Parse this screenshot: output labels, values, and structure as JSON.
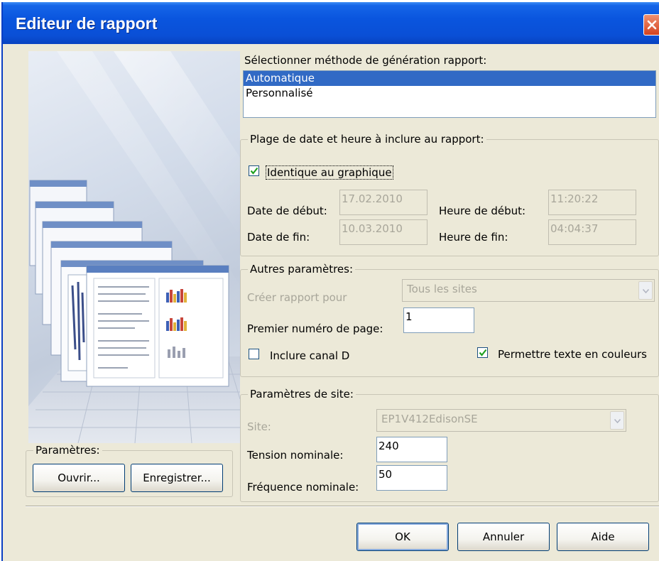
{
  "window": {
    "title": "Editeur de rapport"
  },
  "method": {
    "label": "Sélectionner méthode de génération rapport:",
    "options": [
      "Automatique",
      "Personnalisé"
    ],
    "selected_index": 0
  },
  "date_range": {
    "group_label": "Plage de date et heure à inclure au rapport:",
    "same_as_graph_label": "Identique au graphique",
    "same_as_graph_checked": true,
    "start_date_label": "Date de début:",
    "start_date": "17.02.2010",
    "start_time_label": "Heure de début:",
    "start_time": "11:20:22",
    "end_date_label": "Date de fin:",
    "end_date": "10.03.2010",
    "end_time_label": "Heure de fin:",
    "end_time": "04:04:37"
  },
  "other": {
    "group_label": "Autres paramètres:",
    "create_for_label": "Créer rapport pour",
    "create_for_value": "Tous les sites",
    "first_page_label": "Premier numéro de page:",
    "first_page_value": "1",
    "include_d_label": "Inclure canal D",
    "include_d_checked": false,
    "color_text_label": "Permettre texte en couleurs",
    "color_text_checked": true
  },
  "site": {
    "group_label": "Paramètres de site:",
    "site_label": "Site:",
    "site_value": "EP1V412EdisonSE",
    "voltage_label": "Tension nominale:",
    "voltage_value": "240",
    "frequency_label": "Fréquence nominale:",
    "frequency_value": "50"
  },
  "params": {
    "group_label": "Paramètres:",
    "open_label": "Ouvrir...",
    "save_label": "Enregistrer..."
  },
  "footer": {
    "ok_label": "OK",
    "cancel_label": "Annuler",
    "help_label": "Aide"
  },
  "colors": {
    "title_blue": "#0a55de",
    "selection": "#316ac5",
    "dialog_bg": "#ece9d8"
  }
}
